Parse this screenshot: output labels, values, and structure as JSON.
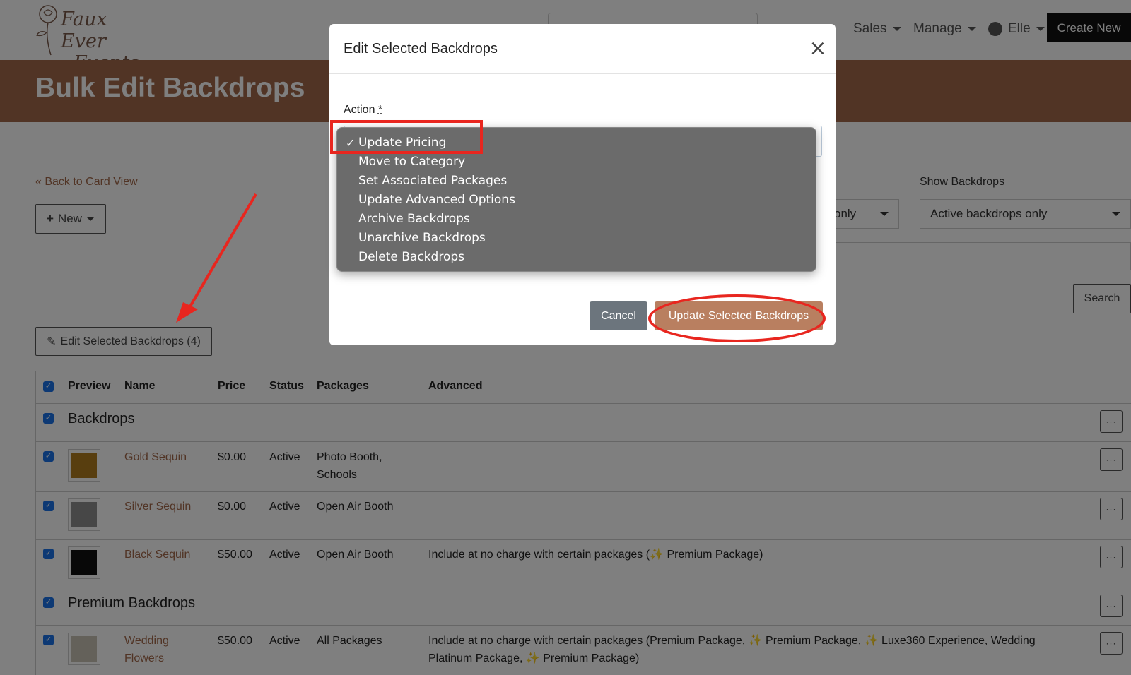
{
  "brand": {
    "logo_line1": "Faux Ever",
    "logo_line2": "Events"
  },
  "nav": {
    "sales": "Sales",
    "manage": "Manage",
    "user": "Elle",
    "create_new": "Create New"
  },
  "page": {
    "title": "Bulk Edit Backdrops",
    "back_link": "« Back to Card View",
    "new_button": "New",
    "edit_selected_button": "Edit Selected Backdrops (4)",
    "filter_partial_value": "only",
    "show_backdrops_label": "Show Backdrops",
    "show_backdrops_value": "Active backdrops only",
    "search_button": "Search"
  },
  "table": {
    "headers": {
      "preview": "Preview",
      "name": "Name",
      "price": "Price",
      "status": "Status",
      "packages": "Packages",
      "advanced": "Advanced"
    },
    "groups": [
      {
        "title": "Backdrops",
        "rows": [
          {
            "name": "Gold Sequin",
            "price": "$0.00",
            "status": "Active",
            "packages_1": "Photo Booth,",
            "packages_2": "Schools",
            "advanced": ""
          },
          {
            "name": "Silver Sequin",
            "price": "$0.00",
            "status": "Active",
            "packages_1": "Open Air Booth",
            "packages_2": "",
            "advanced": ""
          },
          {
            "name": "Black Sequin",
            "price": "$50.00",
            "status": "Active",
            "packages_1": "Open Air Booth",
            "packages_2": "",
            "advanced": "Include at no charge with certain packages (✨ Premium Package)"
          }
        ]
      },
      {
        "title": "Premium Backdrops",
        "rows": [
          {
            "name_1": "Wedding",
            "name_2": "Flowers",
            "price": "$50.00",
            "status": "Active",
            "packages_1": "All Packages",
            "advanced_1": "Include at no charge with certain packages (Premium Package, ✨ Premium Package, ✨ Luxe360 Experience, Wedding",
            "advanced_2": "Platinum Package, ✨ Premium Package)"
          }
        ]
      }
    ],
    "more_label": "···"
  },
  "modal": {
    "title": "Edit Selected Backdrops",
    "action_label": "Action",
    "action_required": "*",
    "options": [
      "Update Pricing",
      "Move to Category",
      "Set Associated Packages",
      "Update Advanced Options",
      "Archive Backdrops",
      "Unarchive Backdrops",
      "Delete Backdrops"
    ],
    "selected_check": "✓",
    "cancel": "Cancel",
    "submit": "Update Selected Backdrops",
    "close": "×"
  },
  "colors": {
    "accent": "#a3694a",
    "annotation": "#e8261f",
    "checkbox": "#1a73e8"
  }
}
